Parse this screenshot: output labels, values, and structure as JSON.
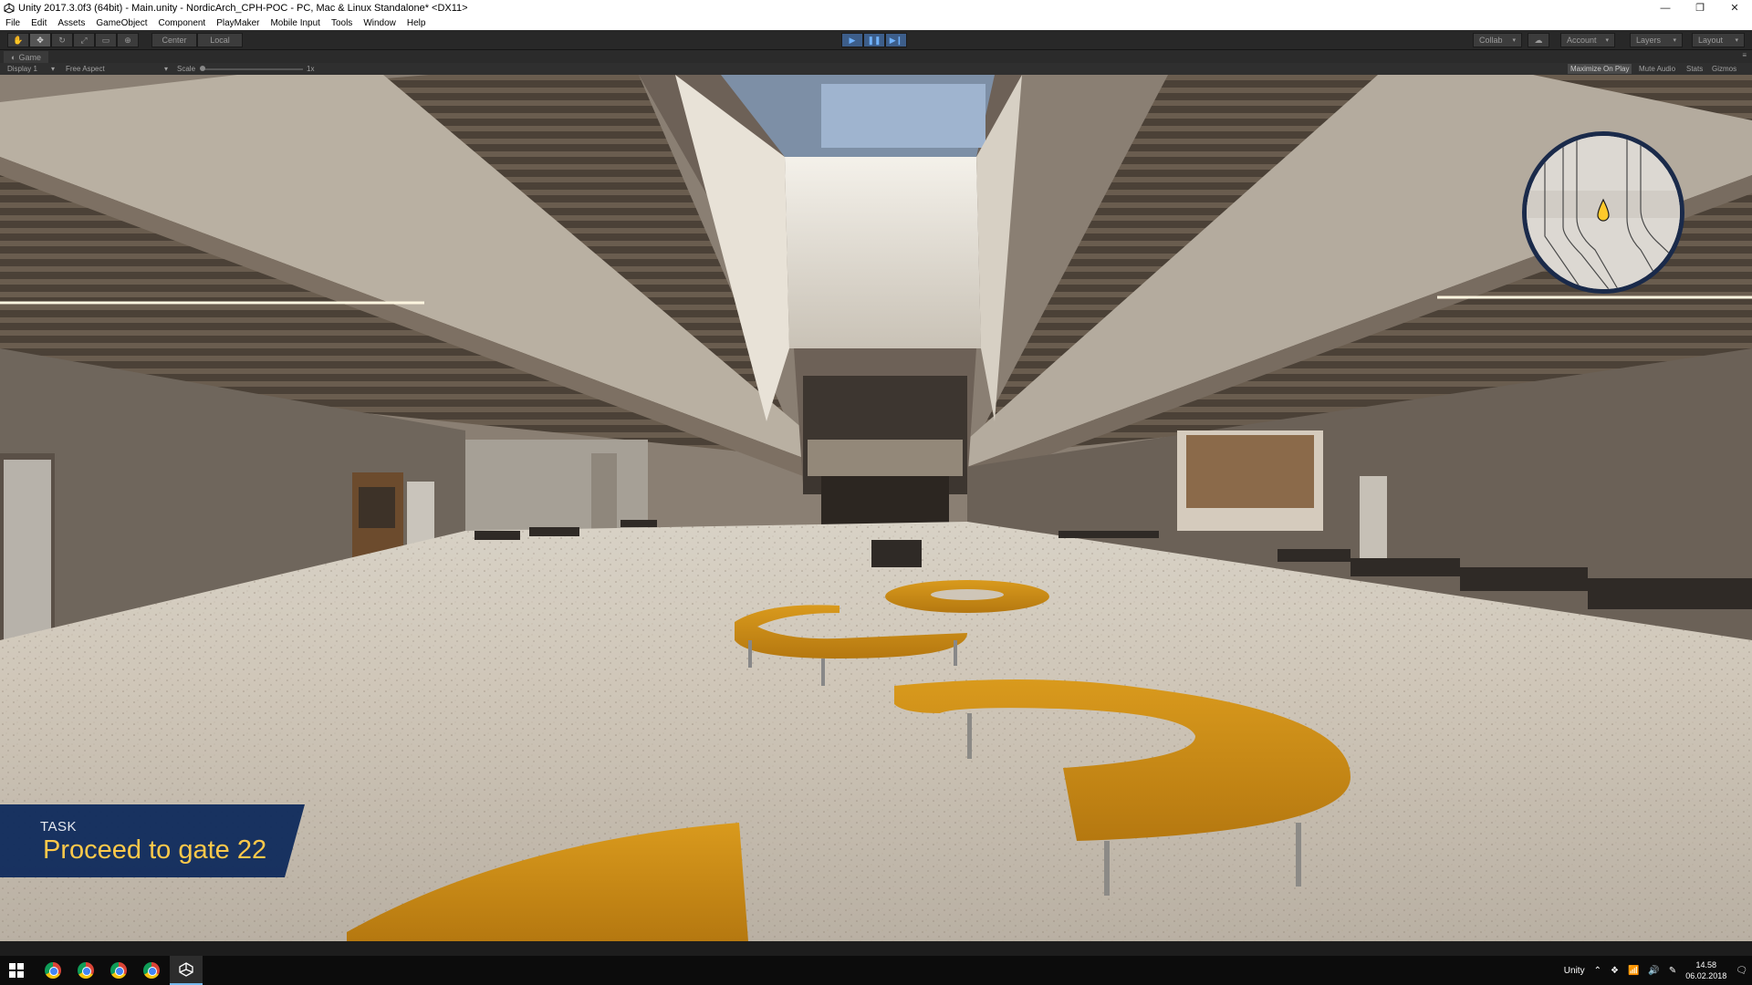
{
  "titlebar": {
    "title": "Unity 2017.3.0f3 (64bit) - Main.unity - NordicArch_CPH-POC - PC, Mac & Linux Standalone* <DX11>",
    "minimize": "—",
    "restore": "❐",
    "close": "✕"
  },
  "menu": [
    "File",
    "Edit",
    "Assets",
    "GameObject",
    "Component",
    "PlayMaker",
    "Mobile Input",
    "Tools",
    "Window",
    "Help"
  ],
  "toolbar": {
    "pivot_center": "Center",
    "pivot_local": "Local",
    "collab": "Collab",
    "account": "Account",
    "layers": "Layers",
    "layout": "Layout"
  },
  "game_tab": {
    "label": "Game"
  },
  "game_bar": {
    "display": "Display 1",
    "aspect": "Free Aspect",
    "scale_label": "Scale",
    "scale_value": "1x",
    "maximize": "Maximize On Play",
    "mute": "Mute Audio",
    "stats": "Stats",
    "gizmos": "Gizmos"
  },
  "task": {
    "label": "TASK",
    "text": "Proceed to gate 22"
  },
  "taskbar": {
    "tray_label": "Unity",
    "time": "14.58",
    "date": "06.02.2018"
  },
  "colors": {
    "task_panel": "#0f2a5c",
    "task_text": "#ffc94a",
    "bench": "#c98a14",
    "play_blue": "#3d5e8a"
  }
}
